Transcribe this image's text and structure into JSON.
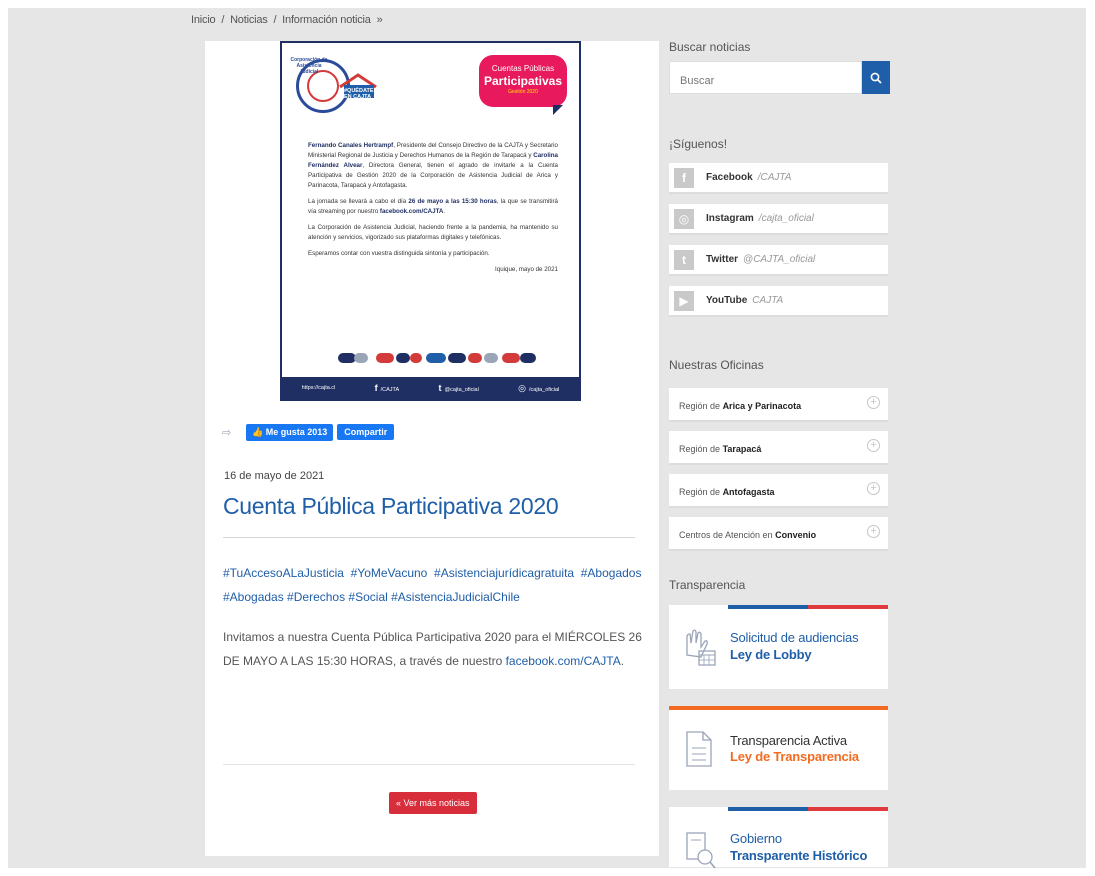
{
  "breadcrumb": {
    "home": "Inicio",
    "sep1": "/",
    "news": "Noticias",
    "sep2": "/",
    "current": "Información noticia",
    "arrow": "»"
  },
  "poster": {
    "logo_text": "Corporación de Asistencia Judicial",
    "house_label": "#QUÉDATE EN CAJTA",
    "bubble_line1": "Cuentas Públicas",
    "bubble_line2": "Participativas",
    "bubble_line3": "Gestión 2020",
    "p1_bold1": "Fernando Canales Hertrampf",
    "p1_a": ", Presidente del Consejo Directivo de la CAJTA y Secretario Ministerial Regional de Justicia y Derechos Humanos de la Región de Tarapacá y ",
    "p1_bold2": "Carolina Fernández Alvear",
    "p1_b": ", Directora General, tienen el agrado de invitarle a la Cuenta Participativa de Gestión 2020 de la Corporación de Asistencia Judicial de Arica y Parinacota, Tarapacá y Antofagasta.",
    "p2_a": "La jornada se llevará a cabo el día ",
    "p2_bold": "26 de mayo a las 15:30 horas",
    "p2_b": ", la que se transmitirá vía streaming por nuestro ",
    "p2_bold2": "facebook.com/CAJTA",
    "p2_c": ".",
    "p3": "La Corporación de Asistencia Judicial, haciendo frente a la pandemia, ha mantenido su atención y servicios, vigorizado sus plataformas digitales y telefónicas.",
    "p4": "Esperamos contar con vuestra distinguida sintonía y participación.",
    "sign": "Iquique, mayo de 2021",
    "footer_web": "https://cajta.cl",
    "footer_fb": "/CAJTA",
    "footer_tw": "@cajta_oficial",
    "footer_ig": "/cajta_oficial"
  },
  "share": {
    "like_label": "Me gusta 2013",
    "share_label": "Compartir"
  },
  "article": {
    "date": "16 de mayo de 2021",
    "title": "Cuenta Pública Participativa 2020",
    "hashtags_line1": "#TuAccesoALaJusticia  #YoMeVacuno  #Asistenciajurídicagratuita  #Abogados",
    "hashtags_line2": "#Abogadas #Derechos #Social #AsistenciaJudicialChile",
    "body_a": "Invitamos a nuestra Cuenta Pública Participativa 2020 para el MIÉRCOLES 26 DE MAYO A LAS 15:30 HORAS, a través de nuestro ",
    "body_link": "facebook.com/CAJTA",
    "body_b": ".",
    "more_button": "« Ver más noticias"
  },
  "sidebar": {
    "search_heading": "Buscar noticias",
    "search_placeholder": "Buscar",
    "follow_heading": "¡Síguenos!",
    "social": [
      {
        "name": "Facebook",
        "handle": "/CAJTA",
        "glyph": "f"
      },
      {
        "name": "Instagram",
        "handle": "/cajta_oficial",
        "glyph": "◎"
      },
      {
        "name": "Twitter",
        "handle": "@CAJTA_oficial",
        "glyph": "t"
      },
      {
        "name": "YouTube",
        "handle": "CAJTA",
        "glyph": "▶"
      }
    ],
    "offices_heading": "Nuestras Oficinas",
    "offices": [
      {
        "prefix": "Región de",
        "bold": "Arica y Parinacota"
      },
      {
        "prefix": "Región de",
        "bold": "Tarapacá"
      },
      {
        "prefix": "Región de",
        "bold": "Antofagasta"
      },
      {
        "prefix": "Centros de Atención en",
        "bold": "Convenio"
      }
    ],
    "transparency_heading": "Transparencia",
    "transparency": [
      {
        "line1": "Solicitud de audiencias",
        "line2": "Ley de Lobby"
      },
      {
        "line1": "Transparencia Activa",
        "line2": "Ley de Transparencia"
      },
      {
        "line1": "Gobierno",
        "line2": "Transparente Histórico"
      }
    ]
  },
  "colors": {
    "primary_blue": "#1f5ea8",
    "accent_red": "#d82d3a",
    "accent_orange": "#f26b21",
    "facebook_blue": "#1877f2"
  }
}
